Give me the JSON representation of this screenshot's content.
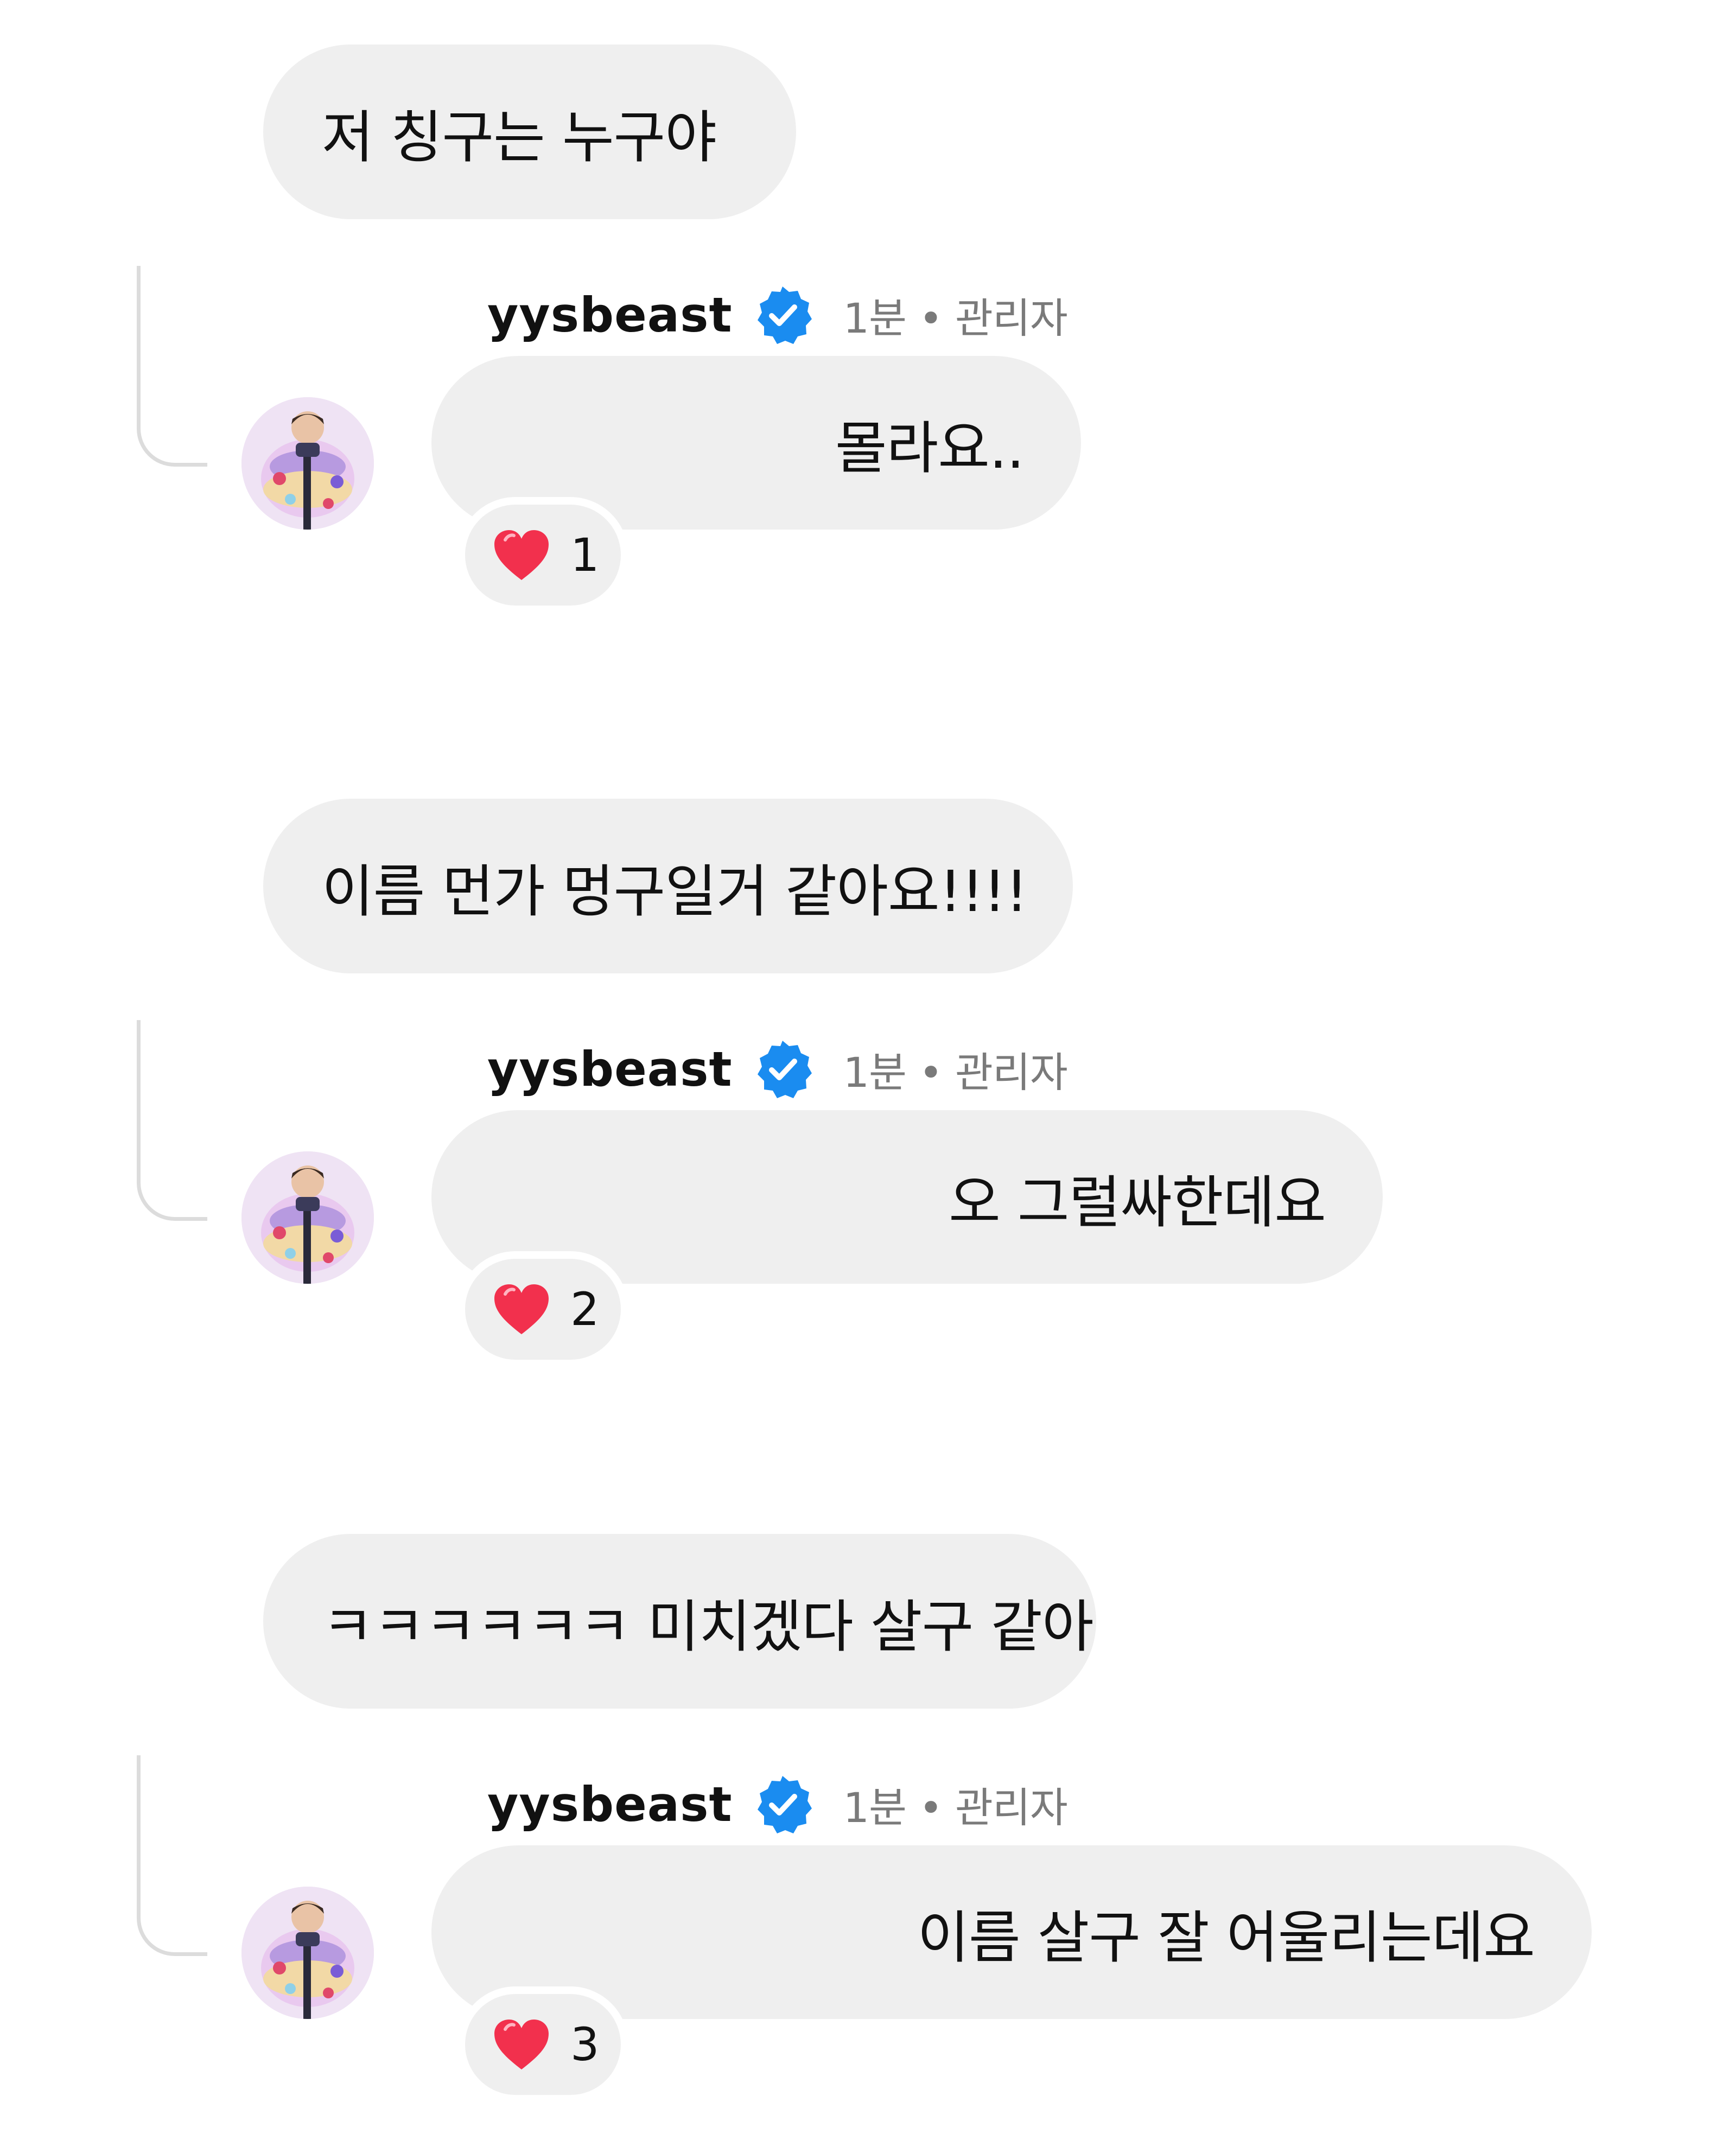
{
  "threads": [
    {
      "comment": {
        "text": "저 칭구는 누구야"
      },
      "reply": {
        "username": "yysbeast",
        "meta": "1분 • 관리자",
        "text": "몰라요..",
        "reaction": {
          "icon": "heart-icon",
          "count": "1"
        }
      }
    },
    {
      "comment": {
        "text": "이름 먼가 멍구일거 같아요!!!!"
      },
      "reply": {
        "username": "yysbeast",
        "meta": "1분 • 관리자",
        "text": "오 그럴싸한데요",
        "reaction": {
          "icon": "heart-icon",
          "count": "2"
        }
      }
    },
    {
      "comment": {
        "text": "ㅋㅋㅋㅋㅋㅋ 미치겠다 살구 같아"
      },
      "reply": {
        "username": "yysbeast",
        "meta": "1분 • 관리자",
        "text": "이름 살구 잘 어울리는데요",
        "reaction": {
          "icon": "heart-icon",
          "count": "3"
        }
      }
    }
  ],
  "icons": {
    "verified": "verified-badge-icon",
    "reaction": "heart-icon",
    "avatar": "profile-avatar"
  },
  "colors": {
    "bubble_bg": "#efefef",
    "verified_blue": "#1a8cf0",
    "heart_red": "#f2304d",
    "meta_gray": "#7a7a7a",
    "connector_gray": "#dcdcdc"
  }
}
